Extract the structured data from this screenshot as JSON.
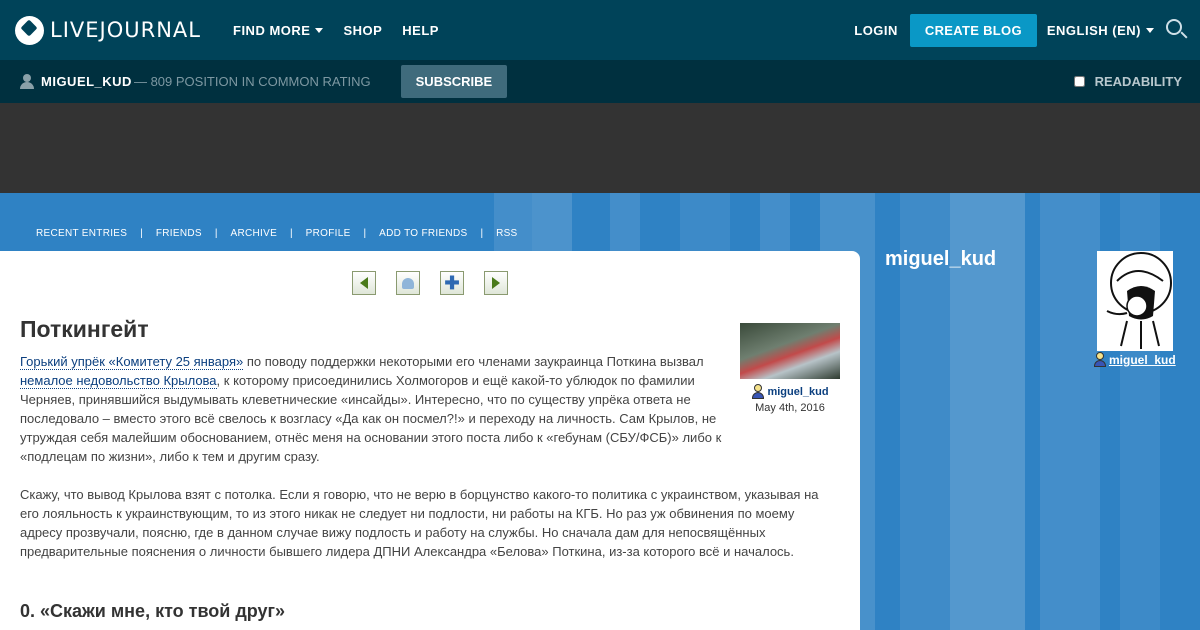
{
  "topbar": {
    "logo": "LIVEJOURNAL",
    "nav": [
      {
        "label": "FIND MORE",
        "dropdown": true
      },
      {
        "label": "SHOP",
        "dropdown": false
      },
      {
        "label": "HELP",
        "dropdown": false
      }
    ],
    "login": "LOGIN",
    "create_blog": "CREATE BLOG",
    "language": "ENGLISH (EN)"
  },
  "journalbar": {
    "username": "MIGUEL_KUD",
    "rating": "— 809 POSITION IN COMMON RATING",
    "subscribe": "SUBSCRIBE",
    "readability": "READABILITY"
  },
  "blognav": [
    "RECENT ENTRIES",
    "FRIENDS",
    "ARCHIVE",
    "PROFILE",
    "ADD TO FRIENDS",
    "RSS"
  ],
  "post": {
    "title": "Поткингейт",
    "link1": "Горький упрёк «Комитету 25 января»",
    "text1": " по поводу поддержки некоторыми его членами заукраинца Поткина вызвал ",
    "link2": "немалое недовольство Крылова",
    "text2": ", к которому присоединились Холмогоров и ещё какой-то ублюдок по фамилии Черняев, принявшийся выдумывать клеветнические «инсайды». Интересно, что по существу упрёка ответа не последовало – вместо этого всё свелось к возгласу «Да как он посмел?!» и переходу на личность. Сам Крылов, не утруждая себя малейшим обоснованием, отнёс меня на основании этого поста либо к «гебунам (СБУ/ФСБ)» либо к «подлецам по жизни», либо к тем и другим сразу.",
    "paragraph2": "Скажу, что вывод Крылова взят с потолка. Если я говорю, что не верю в борцунство какого-то политика с украинством, указывая на его лояльность к украинствующим, то из этого никак не следует ни подлости, ни работы на КГБ. Но раз уж обвинения по моему адресу прозвучали, поясню, где в данном случае вижу подлость и работу на службы. Но сначала дам для непосвящённых предварительные пояснения о личности бывшего лидера ДПНИ Александра «Белова» Поткина, из-за которого всё и началось.",
    "section_heading": "0. «Скажи мне, кто твой друг»",
    "author": "miguel_kud",
    "date": "May 4th, 2016"
  },
  "sidebar": {
    "title": "miguel_kud",
    "username": "miguel_kud"
  }
}
